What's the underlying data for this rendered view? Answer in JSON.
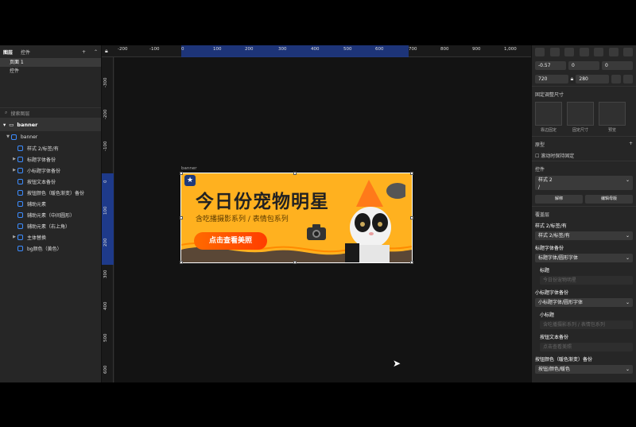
{
  "left_panel": {
    "tabs": [
      "图层",
      "控件"
    ],
    "pages": [
      "页面 1",
      "控件"
    ],
    "search_placeholder": "搜索图层",
    "artboard": "banner",
    "group": "banner",
    "layers": [
      {
        "label": "样式 2/标签/有",
        "expandable": false
      },
      {
        "label": "标题字体备份",
        "expandable": true
      },
      {
        "label": "小标题字体备份",
        "expandable": true
      },
      {
        "label": "按钮文本备份",
        "expandable": false
      },
      {
        "label": "按钮颜色（暖色渐变）备份",
        "expandable": false
      },
      {
        "label": "辅助元素",
        "expandable": false
      },
      {
        "label": "辅助元素（中间圆形）",
        "expandable": false
      },
      {
        "label": "辅助元素（右上角）",
        "expandable": false
      },
      {
        "label": "主体替换",
        "expandable": true
      },
      {
        "label": "bg颜色（黄色）",
        "expandable": false
      }
    ]
  },
  "ruler": {
    "h_ticks": [
      "-200",
      "-100",
      "0",
      "100",
      "200",
      "300",
      "400",
      "500",
      "600",
      "700",
      "800",
      "900",
      "1,000"
    ],
    "v_ticks": [
      "-300",
      "-200",
      "-100",
      "0",
      "100",
      "200",
      "300",
      "400",
      "500",
      "600"
    ]
  },
  "banner": {
    "label": "banner",
    "title": "今日份宠物明星",
    "subtitle": "含吃播摄影系列 / 表情包系列",
    "button": "点击查看美照"
  },
  "right_panel": {
    "x": "-0.57",
    "y": "0",
    "rot": "0",
    "w": "720",
    "h": "280",
    "resize_title": "固定调整尺寸",
    "resize_labels": [
      "靠边固定",
      "固定尺寸",
      "预览"
    ],
    "prototype": "原型",
    "fix_scroll": "滚动时保持固定",
    "component_title": "控件",
    "component_name": "样式 2",
    "component_sub": "/",
    "detach": "解绑",
    "edit_master": "编辑母版",
    "overrides_title": "覆盖层",
    "overrides": [
      {
        "label": "样式 2/标签/有",
        "value": "样式 2/标签/有",
        "type": "select"
      },
      {
        "label": "标题字体备份",
        "value": "标题字体/圆形字体",
        "type": "select"
      },
      {
        "label": "标题",
        "value": "今日份宠物明星",
        "type": "text"
      },
      {
        "label": "小标题字体备份",
        "value": "小标题字体/圆形字体",
        "type": "select"
      },
      {
        "label": "小标题",
        "value": "含吃播摄影系列 / 表情包系列",
        "type": "text"
      },
      {
        "label": "按钮文本备份",
        "value": "点击查看美照",
        "type": "text"
      },
      {
        "label": "按钮颜色（暖色渐变）备份",
        "value": "按钮/颜色/暖色",
        "type": "select"
      }
    ]
  },
  "colors": {
    "accent": "#1e3a8a",
    "banner_bg": "#ffb11f",
    "button": "#ff5200"
  }
}
